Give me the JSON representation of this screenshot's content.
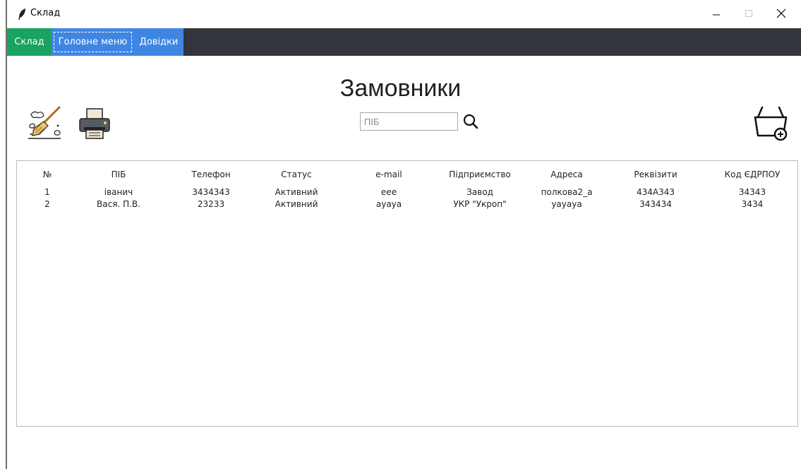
{
  "window": {
    "title": "Склад"
  },
  "menu": {
    "items": [
      {
        "label": "Склад"
      },
      {
        "label": "Головне меню"
      },
      {
        "label": "Довідки"
      }
    ]
  },
  "page": {
    "title": "Замовники"
  },
  "search": {
    "placeholder": "ПІБ"
  },
  "table": {
    "columns": [
      "№",
      "ПІБ",
      "Телефон",
      "Статус",
      "e-mail",
      "Підприємство",
      "Адреса",
      "Реквізити",
      "Код ЄДРПОУ"
    ],
    "rows": [
      [
        "1",
        "іванич",
        "3434343",
        "Активний",
        "eee",
        "Завод",
        "полкова2_а",
        "434А343",
        "34343"
      ],
      [
        "2",
        "Вася. П.В.",
        "23233",
        "Активний",
        "ayaya",
        "УКР \"Укроп\"",
        "yayaya",
        "343434",
        "3434"
      ]
    ]
  },
  "icons": {
    "app": "feather-icon",
    "clear": "broom-icon",
    "print": "printer-icon",
    "add": "basket-add-icon",
    "search": "search-icon"
  },
  "colors": {
    "menubar": "#32353b",
    "menu_active": "#1aa260",
    "menu_blue": "#3f86e3"
  }
}
